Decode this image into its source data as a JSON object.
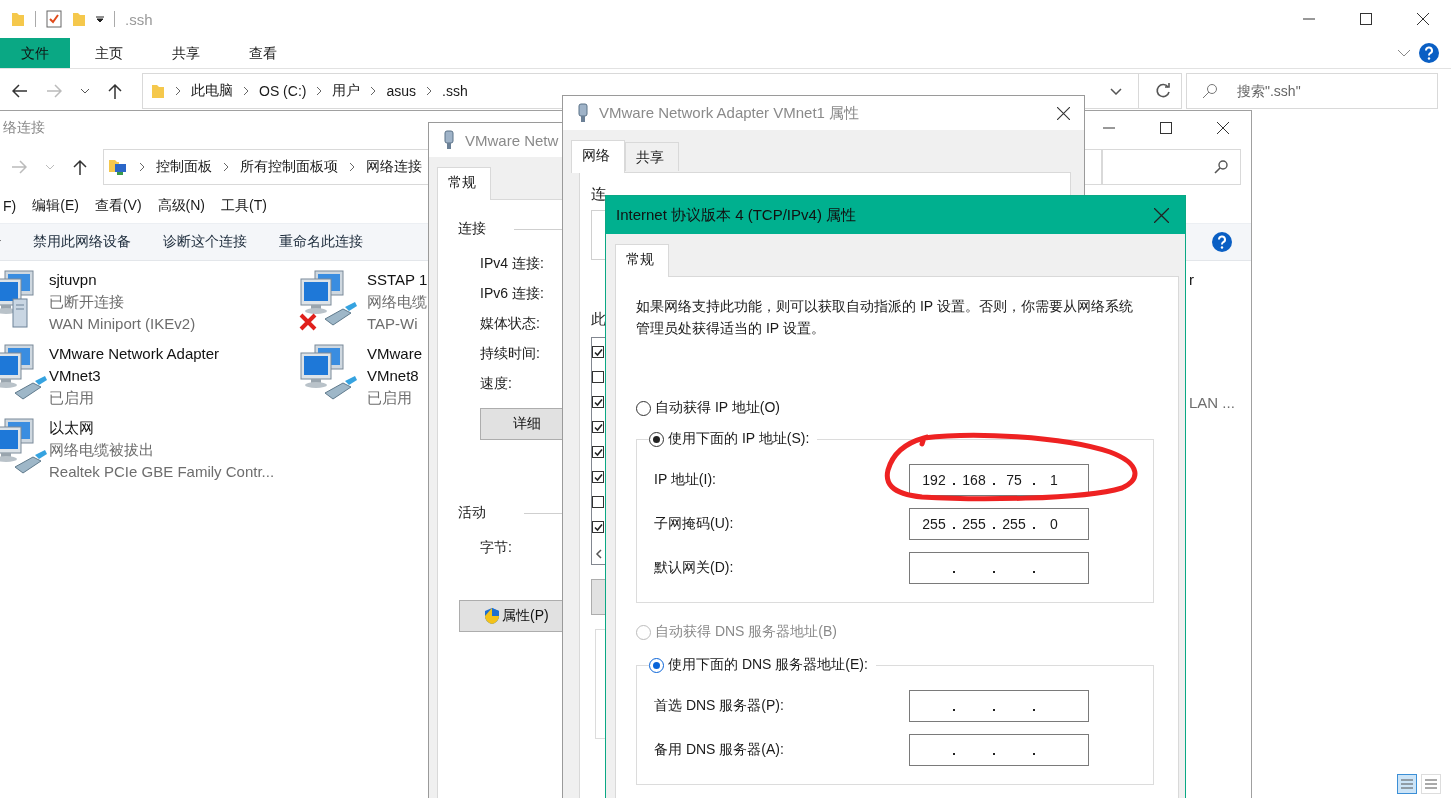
{
  "explorer": {
    "title": ".ssh",
    "ribbon_tabs": [
      {
        "label": "文件",
        "selected": true
      },
      {
        "label": "主页",
        "selected": false
      },
      {
        "label": "共享",
        "selected": false
      },
      {
        "label": "查看",
        "selected": false
      }
    ],
    "breadcrumb": [
      "此电脑",
      "OS (C:)",
      "用户",
      "asus",
      ".ssh"
    ],
    "search": {
      "placeholder": "搜索\".ssh\""
    },
    "view_buttons": [
      {
        "selected": true
      },
      {
        "selected": false
      }
    ]
  },
  "network_window": {
    "title": "络连接",
    "breadcrumb": [
      "控制面板",
      "所有控制面板项",
      "网络连接"
    ],
    "menu": [
      "F)",
      "编辑(E)",
      "查看(V)",
      "高级(N)",
      "工具(T)"
    ],
    "toolbar": [
      "禁用此网络设备",
      "诊断这个连接",
      "重命名此连接"
    ],
    "connections": [
      {
        "kind": "vpn",
        "name_lines": [
          "sjtuvpn"
        ],
        "status": "已断开连接",
        "device": "WAN Miniport (IKEv2)"
      },
      {
        "kind": "disconnected",
        "name_lines": [
          "SSTAP 1"
        ],
        "status": "网络电缆",
        "device": "TAP-Wi"
      },
      {
        "name_lines": [
          "r"
        ]
      },
      {
        "kind": "enabled",
        "name_lines": [
          "VMware Network Adapter",
          "VMnet3"
        ],
        "status": "已启用"
      },
      {
        "kind": "enabled",
        "name_lines": [
          "VMware",
          "VMnet8"
        ],
        "status": "已启用"
      },
      {
        "device": "LAN ..."
      },
      {
        "kind": "enabled",
        "name_lines": [
          "以太网"
        ],
        "status": "网络电缆被拔出",
        "device": "Realtek PCIe GBE Family Contr..."
      }
    ]
  },
  "status_window": {
    "title": "VMware Netw",
    "tabs": [
      {
        "label": "常规",
        "selected": true
      }
    ],
    "connection_heading": "连接",
    "fields": [
      "IPv4 连接:",
      "IPv6 连接:",
      "媒体状态:",
      "持续时间:",
      "速度:"
    ],
    "details_button": "详细",
    "activity_heading": "活动",
    "bytes_label": "字节:",
    "properties_button": "属性(P)"
  },
  "adapter_window": {
    "title": "VMware Network Adapter VMnet1 属性",
    "tabs": [
      {
        "label": "网络",
        "selected": true
      },
      {
        "label": "共享",
        "selected": false
      }
    ],
    "connect_label": "连",
    "items_label": "此",
    "components": [
      {
        "checked": true
      },
      {
        "checked": false
      },
      {
        "checked": true
      },
      {
        "checked": true
      },
      {
        "checked": true
      },
      {
        "checked": true
      },
      {
        "checked": false
      },
      {
        "checked": true
      }
    ]
  },
  "ipv4_dialog": {
    "title": "Internet 协议版本 4 (TCP/IPv4) 属性",
    "tabs": [
      {
        "label": "常规",
        "selected": true
      }
    ],
    "description": "如果网络支持此功能，则可以获取自动指派的 IP 设置。否则，你需要从网络系统管理员处获得适当的 IP 设置。",
    "ip_options": [
      {
        "label": "自动获得 IP 地址(O)",
        "selected": false,
        "disabled": false
      },
      {
        "label": "使用下面的 IP 地址(S):",
        "selected": true,
        "disabled": false
      }
    ],
    "ip_fields": [
      {
        "label": "IP 地址(I):",
        "octets": [
          "192",
          "168",
          "75",
          "1"
        ]
      },
      {
        "label": "子网掩码(U):",
        "octets": [
          "255",
          "255",
          "255",
          "0"
        ]
      },
      {
        "label": "默认网关(D):"
      }
    ],
    "dns_options": [
      {
        "label": "自动获得 DNS 服务器地址(B)",
        "selected": false,
        "disabled": true
      },
      {
        "label": "使用下面的 DNS 服务器地址(E):",
        "selected": true,
        "disabled": false
      }
    ],
    "dns_fields": [
      {
        "label": "首选 DNS 服务器(P):"
      },
      {
        "label": "备用 DNS 服务器(A):"
      }
    ],
    "annotation": {
      "kind": "freehand-ellipse"
    }
  }
}
